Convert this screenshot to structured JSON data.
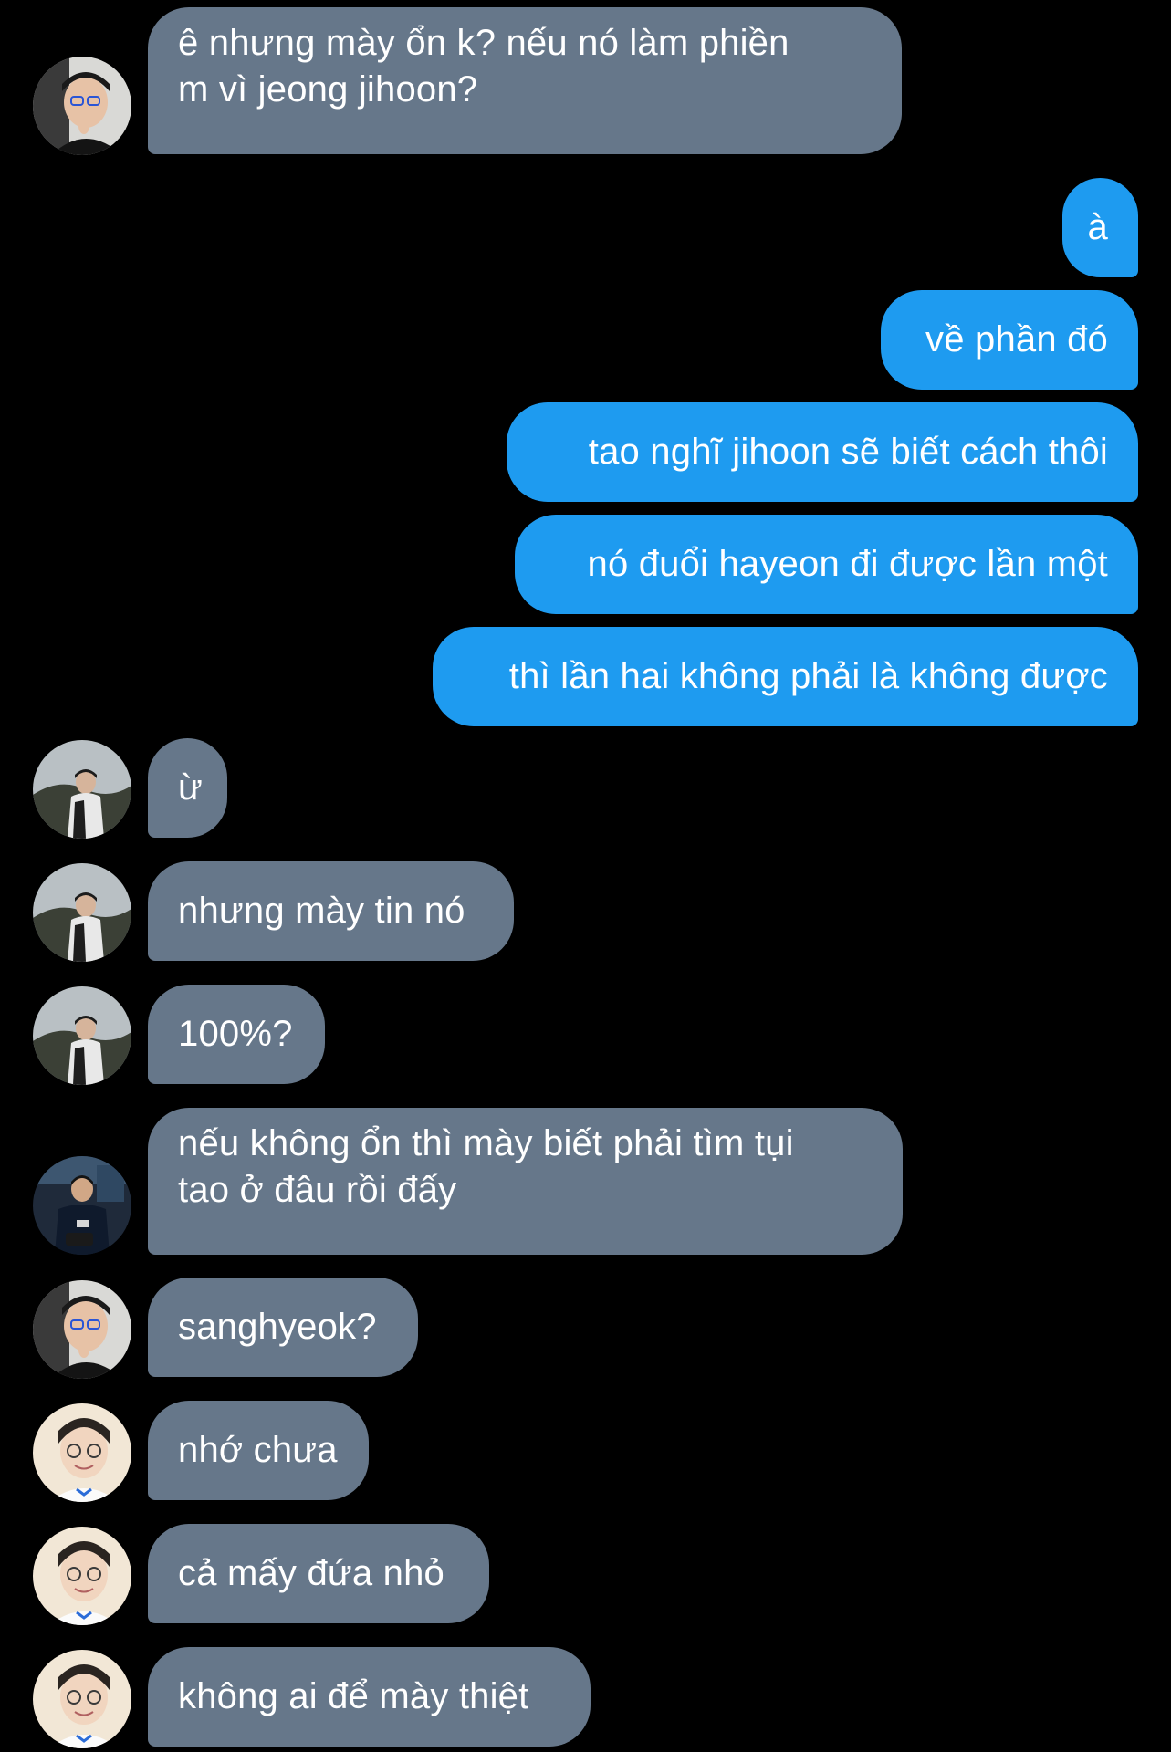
{
  "colors": {
    "background": "#000000",
    "incoming_bubble": "#66778a",
    "outgoing_bubble": "#1e9bf0",
    "text": "#ffffff"
  },
  "messages": [
    {
      "sender": "incoming",
      "avatar_icon": "user-avatar-glasses-icon",
      "text": "ê nhưng mày ổn k? nếu nó làm phiền\nm vì jeong jihoon?"
    },
    {
      "sender": "outgoing",
      "text": "à"
    },
    {
      "sender": "outgoing",
      "text": "về phần đó"
    },
    {
      "sender": "outgoing",
      "text": "tao nghĩ jihoon sẽ biết cách thôi"
    },
    {
      "sender": "outgoing",
      "text": "nó đuổi hayeon đi được lần một"
    },
    {
      "sender": "outgoing",
      "text": "thì lần hai không phải là không được"
    },
    {
      "sender": "incoming",
      "avatar_icon": "user-avatar-outdoor-icon",
      "text": "ừ"
    },
    {
      "sender": "incoming",
      "avatar_icon": "user-avatar-outdoor-icon",
      "text": "nhưng mày tin nó"
    },
    {
      "sender": "incoming",
      "avatar_icon": "user-avatar-outdoor-icon",
      "text": "100%?"
    },
    {
      "sender": "incoming",
      "avatar_icon": "user-avatar-jersey-icon",
      "text": "nếu không ổn thì mày biết phải tìm tụi\ntao ở đâu rồi đấy"
    },
    {
      "sender": "incoming",
      "avatar_icon": "user-avatar-glasses-icon",
      "text": "sanghyeok?"
    },
    {
      "sender": "incoming",
      "avatar_icon": "user-avatar-smiling-icon",
      "text": "nhớ chưa"
    },
    {
      "sender": "incoming",
      "avatar_icon": "user-avatar-smiling-icon",
      "text": "cả mấy đứa nhỏ"
    },
    {
      "sender": "incoming",
      "avatar_icon": "user-avatar-smiling-icon",
      "text": "không ai để mày thiệt"
    }
  ]
}
